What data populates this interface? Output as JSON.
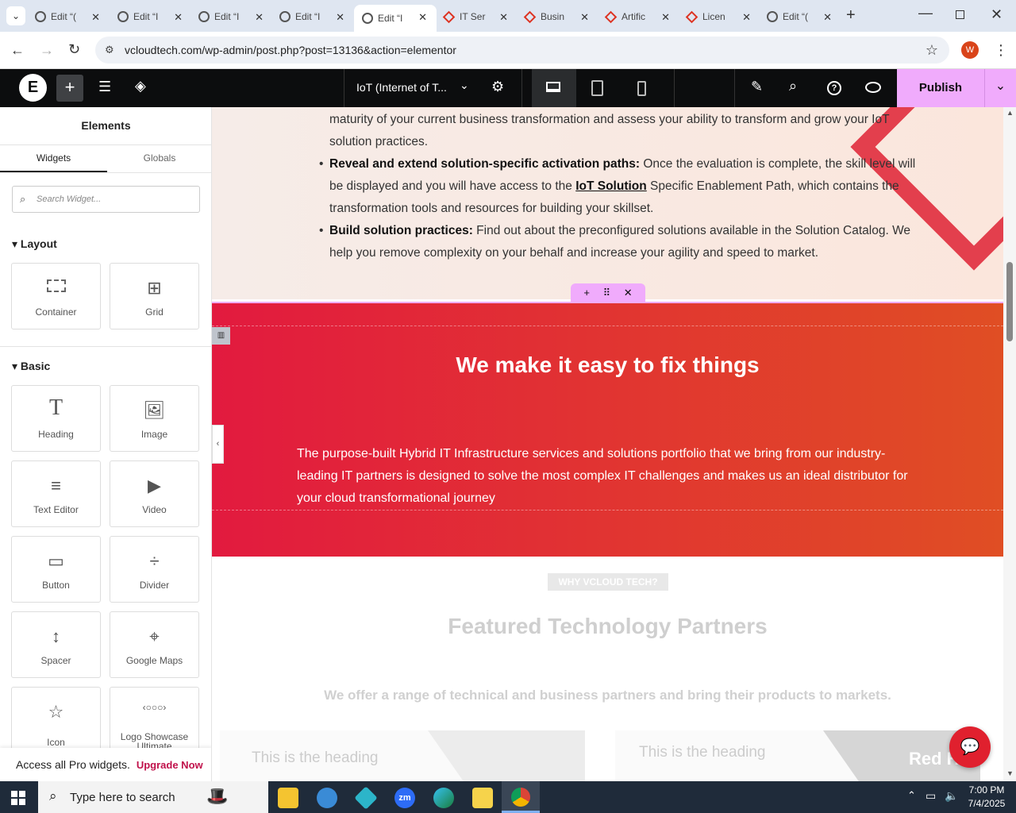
{
  "browser": {
    "tabs": [
      {
        "title": "Edit “(",
        "icon": "globe-icon"
      },
      {
        "title": "Edit “I",
        "icon": "globe-icon"
      },
      {
        "title": "Edit “I",
        "icon": "globe-icon"
      },
      {
        "title": "Edit “I",
        "icon": "globe-icon"
      },
      {
        "title": "Edit “I",
        "icon": "globe-icon"
      },
      {
        "title": "IT Ser",
        "icon": "vcloud-icon"
      },
      {
        "title": "Busin",
        "icon": "vcloud-icon"
      },
      {
        "title": "Artific",
        "icon": "vcloud-icon"
      },
      {
        "title": "Licen",
        "icon": "vcloud-icon"
      },
      {
        "title": "Edit “(",
        "icon": "globe-icon"
      }
    ],
    "url": "vcloudtech.com/wp-admin/post.php?post=13136&action=elementor",
    "profile_initial": "W"
  },
  "editor": {
    "page_title": "IoT (Internet of T...",
    "publish_label": "Publish"
  },
  "panel": {
    "title": "Elements",
    "tabs": [
      "Widgets",
      "Globals"
    ],
    "search_placeholder": "Search Widget...",
    "layout_label": "Layout",
    "basic_label": "Basic",
    "layout_widgets": [
      "Container",
      "Grid"
    ],
    "basic_widgets": [
      "Heading",
      "Image",
      "Text Editor",
      "Video",
      "Button",
      "Divider",
      "Spacer",
      "Google Maps",
      "Icon",
      "Logo Showcase Ultimate"
    ],
    "pro_text": "Access all Pro widgets.",
    "upgrade_label": "Upgrade Now"
  },
  "content": {
    "top_text_1": "maturity of your current business transformation and assess your ability to transform and grow your IoT solution practices.",
    "bullet2_bold": "Reveal and extend solution-specific activation paths:",
    "bullet2_text_a": " Once the evaluation is complete, the skill level will be displayed and you will have access to the ",
    "bullet2_link": "IoT Solution",
    "bullet2_text_b": " Specific Enablement Path, which contains the transformation tools and resources for building your skillset.",
    "bullet3_bold": "Build solution practices:",
    "bullet3_text": " Find out about the preconfigured solutions available in the Solution Catalog. We help you remove complexity on your behalf and increase your agility and speed to market.",
    "red_heading": "We make it easy to fix things",
    "red_text": "The purpose-built Hybrid IT Infrastructure services and solutions portfolio that we bring from our industry-leading IT partners is designed to solve the most complex IT challenges and makes us an ideal distributor for your cloud transformational journey",
    "why_badge": "WHY VCLOUD TECH?",
    "featured_heading": "Featured Technology Partners",
    "featured_sub": "We offer a range of technical and business partners and bring their products to markets.",
    "card1_heading": "This is the heading",
    "card2_heading": "This is the heading",
    "card2_logo": "Red H"
  },
  "taskbar": {
    "search_placeholder": "Type here to search",
    "time": "7:00 PM",
    "date": "7/4/2025"
  }
}
